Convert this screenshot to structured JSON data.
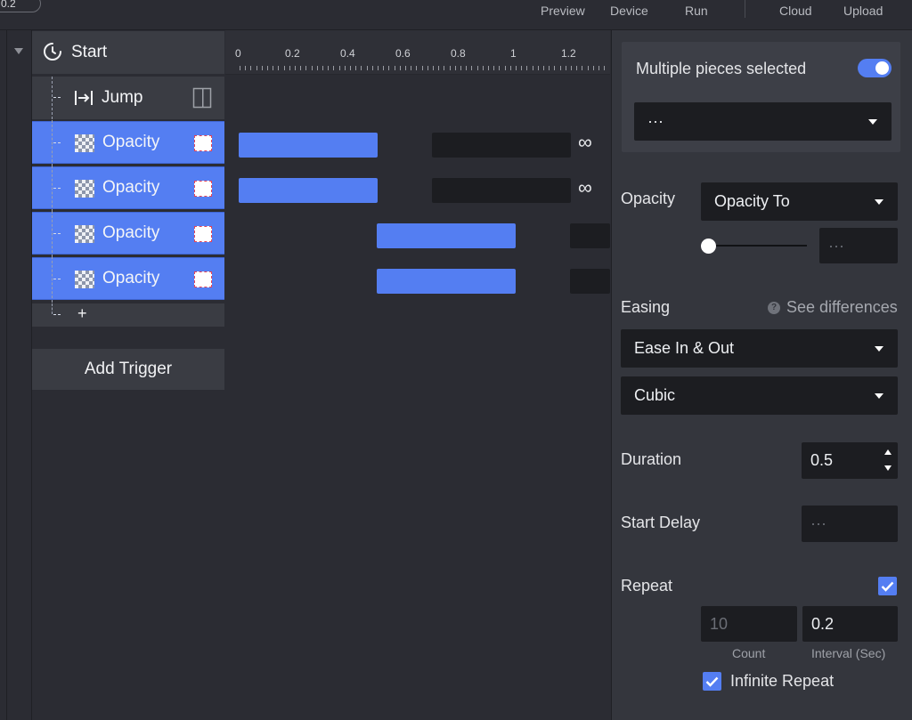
{
  "toolbar": {
    "zoom": "0.2",
    "preview": "Preview",
    "device": "Device",
    "run": "Run",
    "cloud": "Cloud",
    "upload": "Upload"
  },
  "layers": {
    "start": "Start",
    "jump": "Jump",
    "opacity_rows": [
      "Opacity",
      "Opacity",
      "Opacity",
      "Opacity"
    ],
    "add": "+",
    "add_trigger": "Add Trigger"
  },
  "timeline": {
    "ticks": [
      "0",
      "0.2",
      "0.4",
      "0.6",
      "0.8",
      "1",
      "1.2"
    ],
    "infinity": "∞"
  },
  "inspector": {
    "selection_title": "Multiple pieces selected",
    "selection_toggle_on": true,
    "selection_dropdown": "···",
    "opacity_label": "Opacity",
    "opacity_mode": "Opacity To",
    "opacity_value_placeholder": "···",
    "easing_label": "Easing",
    "see_differences": "See differences",
    "easing_type": "Ease In & Out",
    "easing_curve": "Cubic",
    "duration_label": "Duration",
    "duration_value": "0.5",
    "start_delay_label": "Start Delay",
    "start_delay_placeholder": "···",
    "repeat_label": "Repeat",
    "repeat_checked": true,
    "count_value": "10",
    "count_label": "Count",
    "interval_value": "0.2",
    "interval_label": "Interval (Sec)",
    "infinite_repeat_label": "Infinite Repeat",
    "infinite_repeat_checked": true
  },
  "colors": {
    "accent": "#547ef2",
    "panel": "#34363d",
    "field": "#1c1d21",
    "background": "#2b2c33"
  }
}
